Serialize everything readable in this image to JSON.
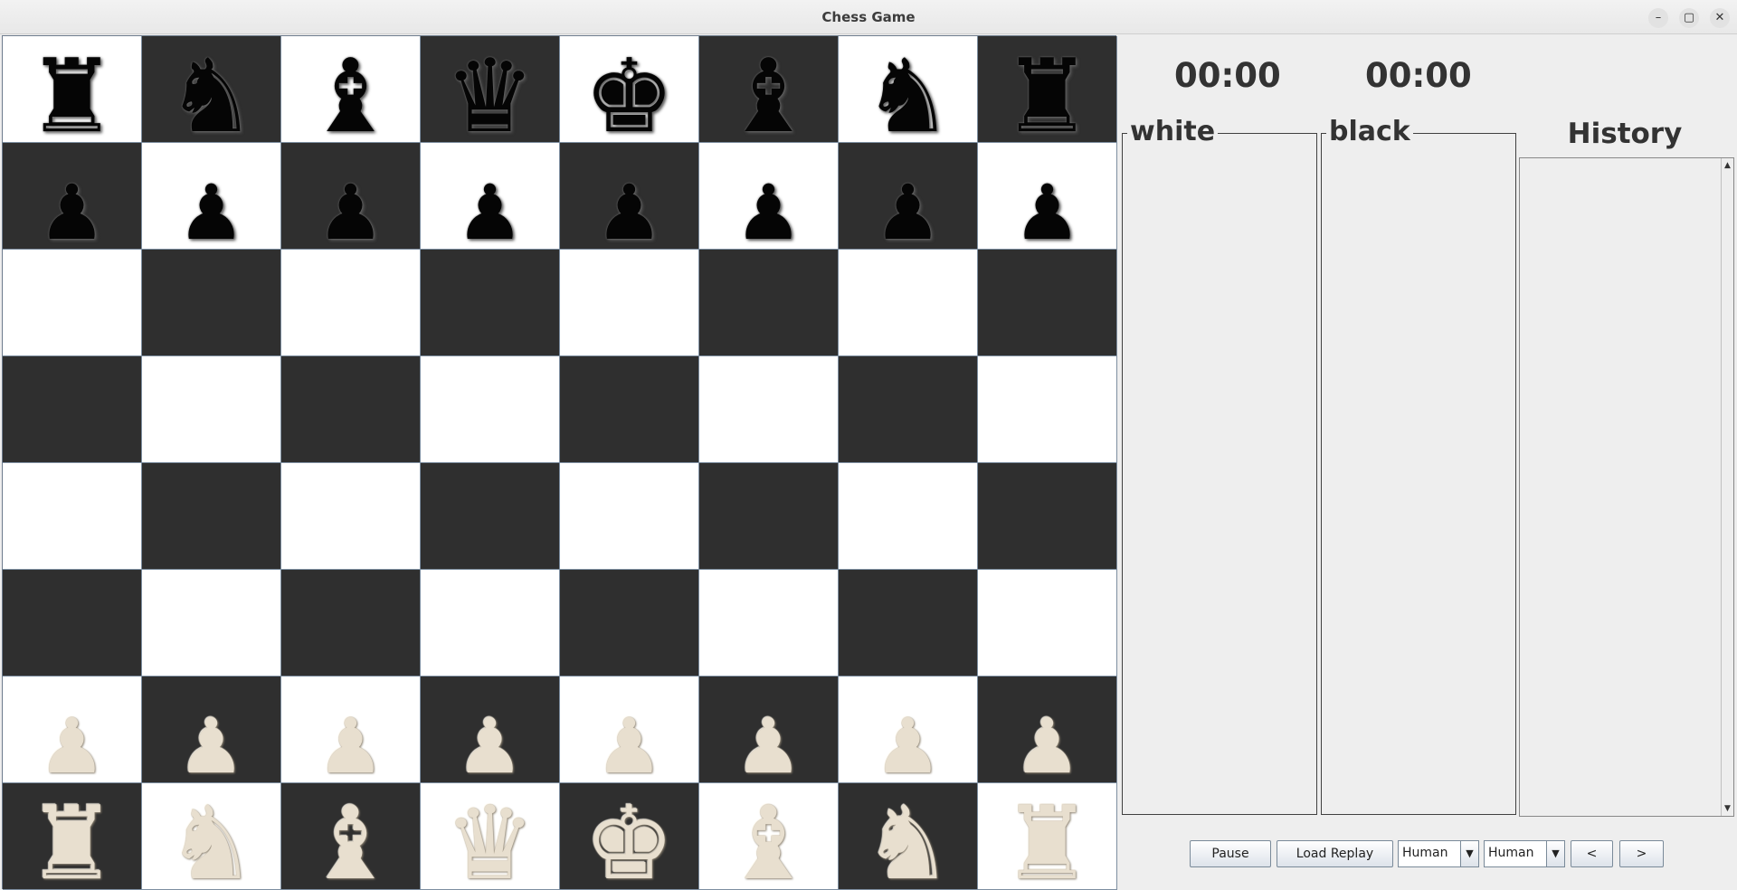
{
  "window": {
    "title": "Chess Game",
    "minimize_icon": "–",
    "maximize_icon": "▢",
    "close_icon": "✕"
  },
  "board": {
    "light_color": "#ffffff",
    "dark_color": "#2f2f2f",
    "ranks": [
      [
        {
          "p": "♜",
          "c": "black",
          "k": "rook"
        },
        {
          "p": "♞",
          "c": "black",
          "k": "knight"
        },
        {
          "p": "♝",
          "c": "black",
          "k": "bishop"
        },
        {
          "p": "♛",
          "c": "black",
          "k": "queen"
        },
        {
          "p": "♚",
          "c": "black",
          "k": "king"
        },
        {
          "p": "♝",
          "c": "black",
          "k": "bishop"
        },
        {
          "p": "♞",
          "c": "black",
          "k": "knight"
        },
        {
          "p": "♜",
          "c": "black",
          "k": "rook"
        }
      ],
      [
        {
          "p": "♟",
          "c": "black",
          "k": "pawn"
        },
        {
          "p": "♟",
          "c": "black",
          "k": "pawn"
        },
        {
          "p": "♟",
          "c": "black",
          "k": "pawn"
        },
        {
          "p": "♟",
          "c": "black",
          "k": "pawn"
        },
        {
          "p": "♟",
          "c": "black",
          "k": "pawn"
        },
        {
          "p": "♟",
          "c": "black",
          "k": "pawn"
        },
        {
          "p": "♟",
          "c": "black",
          "k": "pawn"
        },
        {
          "p": "♟",
          "c": "black",
          "k": "pawn"
        }
      ],
      [
        null,
        null,
        null,
        null,
        null,
        null,
        null,
        null
      ],
      [
        null,
        null,
        null,
        null,
        null,
        null,
        null,
        null
      ],
      [
        null,
        null,
        null,
        null,
        null,
        null,
        null,
        null
      ],
      [
        null,
        null,
        null,
        null,
        null,
        null,
        null,
        null
      ],
      [
        {
          "p": "♟",
          "c": "white",
          "k": "pawn"
        },
        {
          "p": "♟",
          "c": "white",
          "k": "pawn"
        },
        {
          "p": "♟",
          "c": "white",
          "k": "pawn"
        },
        {
          "p": "♟",
          "c": "white",
          "k": "pawn"
        },
        {
          "p": "♟",
          "c": "white",
          "k": "pawn"
        },
        {
          "p": "♟",
          "c": "white",
          "k": "pawn"
        },
        {
          "p": "♟",
          "c": "white",
          "k": "pawn"
        },
        {
          "p": "♟",
          "c": "white",
          "k": "pawn"
        }
      ],
      [
        {
          "p": "♜",
          "c": "white",
          "k": "rook"
        },
        {
          "p": "♞",
          "c": "white",
          "k": "knight"
        },
        {
          "p": "♝",
          "c": "white",
          "k": "bishop"
        },
        {
          "p": "♛",
          "c": "white",
          "k": "queen"
        },
        {
          "p": "♚",
          "c": "white",
          "k": "king"
        },
        {
          "p": "♝",
          "c": "white",
          "k": "bishop"
        },
        {
          "p": "♞",
          "c": "white",
          "k": "knight"
        },
        {
          "p": "♜",
          "c": "white",
          "k": "rook"
        }
      ]
    ]
  },
  "timers": {
    "white": "00:00",
    "black": "00:00"
  },
  "captured": {
    "white_label": "white",
    "black_label": "black"
  },
  "history": {
    "title": "History",
    "scroll_up_icon": "▲",
    "scroll_down_icon": "▼"
  },
  "controls": {
    "pause_label": "Pause",
    "load_replay_label": "Load Replay",
    "player1_value": "Human",
    "player2_value": "Human",
    "dropdown_icon": "▼",
    "prev_label": "<",
    "next_label": ">"
  }
}
